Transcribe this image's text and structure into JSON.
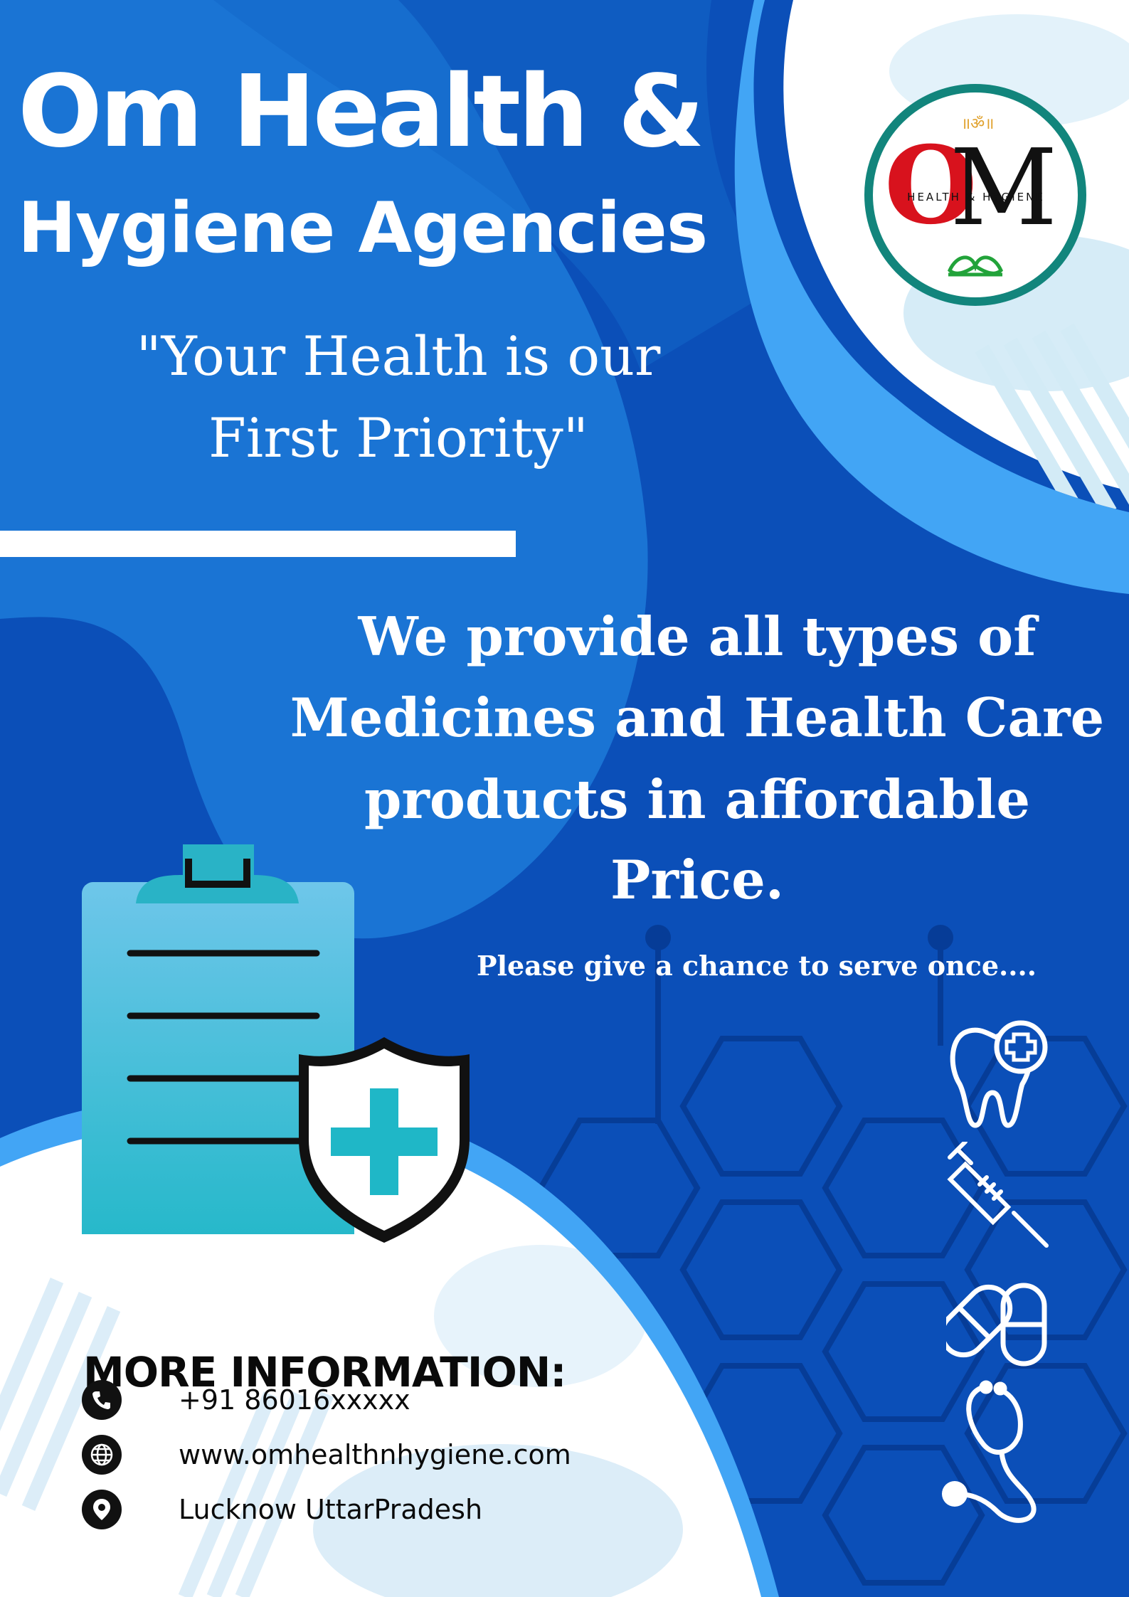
{
  "poster": {
    "title_line1": "Om Health &",
    "title_line2": "Hygiene Agencies",
    "tagline_line1": "\"Your Health is our",
    "tagline_line2": "First Priority\"",
    "claim_line1": "We provide all types of",
    "claim_line2": "Medicines and Health Care",
    "claim_line3": "products in affordable",
    "claim_line4": "Price.",
    "call_to_action": "Please give a chance to serve once...."
  },
  "logo": {
    "om_mark": "॥ॐ॥",
    "letter_o": "O",
    "letter_m": "M",
    "subtitle": "HEALTH & HYGIENE"
  },
  "contact": {
    "heading": "MORE INFORMATION:",
    "phone": "+91 86016xxxxx",
    "website": "www.omhealthnhygiene.com",
    "location": "Lucknow UttarPradesh",
    "phone_icon": "phone-icon",
    "website_icon": "globe-icon",
    "location_icon": "location-pin-icon"
  },
  "colors": {
    "background": "#0b4fb8",
    "accent_light": "#42a5f5",
    "white": "#ffffff",
    "logo_red": "#d8121d",
    "logo_ring": "#12857c",
    "teal": "#1fb7c7"
  },
  "icons": [
    "clipboard-icon",
    "shield-plus-icon",
    "tooth-plus-icon",
    "syringe-icon",
    "pills-icon",
    "stethoscope-icon"
  ]
}
